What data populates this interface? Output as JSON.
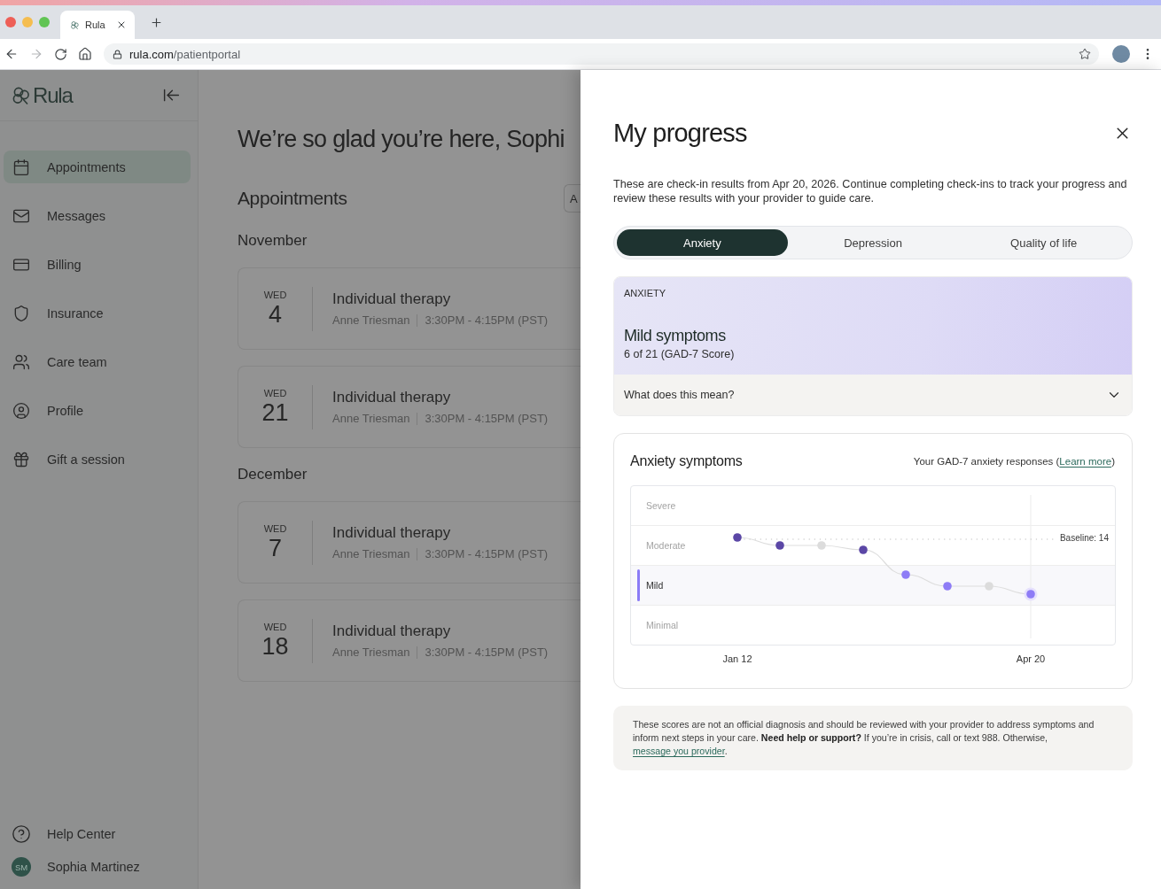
{
  "browser": {
    "tab_title": "Rula",
    "forward_disabled": true,
    "host": "rula.com",
    "path": "/patientportal"
  },
  "sidebar": {
    "brand": "Rula",
    "nav": [
      {
        "label": "Appointments",
        "selected": true
      },
      {
        "label": "Messages",
        "selected": false
      },
      {
        "label": "Billing",
        "selected": false
      },
      {
        "label": "Insurance",
        "selected": false
      },
      {
        "label": "Care team",
        "selected": false
      },
      {
        "label": "Profile",
        "selected": false
      },
      {
        "label": "Gift a session",
        "selected": false
      }
    ],
    "footer": [
      {
        "kind": "help",
        "label": "Help Center"
      },
      {
        "kind": "account",
        "initials": "SM",
        "label": "Sophia Martinez"
      }
    ]
  },
  "main": {
    "greeting": "We’re so glad you’re here, Sophi",
    "section_title": "Appointments",
    "action_label": "A",
    "months": [
      {
        "name": "November",
        "appointments": [
          {
            "weekday": "WED",
            "day": "4",
            "title": "Individual therapy",
            "provider": "Anne Triesman",
            "time": "3:30PM - 4:15PM (PST)"
          },
          {
            "weekday": "WED",
            "day": "21",
            "title": "Individual therapy",
            "provider": "Anne Triesman",
            "time": "3:30PM - 4:15PM (PST)"
          }
        ]
      },
      {
        "name": "December",
        "appointments": [
          {
            "weekday": "WED",
            "day": "7",
            "title": "Individual therapy",
            "provider": "Anne Triesman",
            "time": "3:30PM - 4:15PM (PST)"
          },
          {
            "weekday": "WED",
            "day": "18",
            "title": "Individual therapy",
            "provider": "Anne Triesman",
            "time": "3:30PM - 4:15PM (PST)"
          }
        ]
      }
    ]
  },
  "progress_panel": {
    "title": "My progress",
    "description": "These are check-in results from Apr 20, 2026. Continue completing check-ins to track your progress and review these results with your provider to guide care.",
    "tabs": [
      {
        "label": "Anxiety",
        "selected": true
      },
      {
        "label": "Depression",
        "selected": false
      },
      {
        "label": "Quality of life",
        "selected": false
      }
    ],
    "result": {
      "category": "ANXIETY",
      "severity": "Mild symptoms",
      "score": "6 of 21 (GAD-7 Score)",
      "explainer": "What does this mean?",
      "expanded": false
    },
    "chart": {
      "title": "Anxiety symptoms",
      "subtitle": "Your GAD-7 anxiety responses (",
      "link": "Learn more",
      "subtitle_end": ")",
      "bands": [
        {
          "label": "Severe",
          "selected": false
        },
        {
          "label": "Moderate",
          "selected": false
        },
        {
          "label": "Mild",
          "selected": true
        },
        {
          "label": "Minimal",
          "selected": false
        }
      ],
      "baseline": "Baseline: 14",
      "x_labels": [
        "Jan 12",
        "Apr 20"
      ]
    },
    "note": {
      "text": "These scores are not an official diagnosis and should be reviewed with your provider to address symptoms and inform next steps in your care. **Need help or support?** If you’re in crisis, call or text 988. Otherwise,",
      "link": "message you provider",
      "end": "."
    }
  }
}
